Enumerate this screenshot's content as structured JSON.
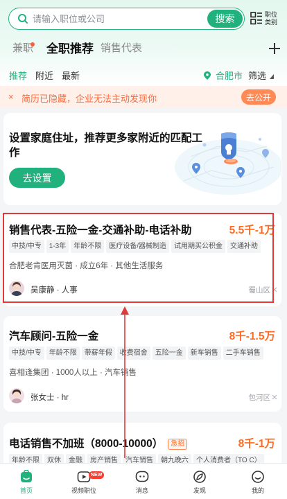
{
  "search": {
    "placeholder": "请输入职位或公司",
    "button_label": "搜索",
    "category_label": "职位类别"
  },
  "tabs": [
    {
      "label": "兼职",
      "has_dot": true
    },
    {
      "label": "全职推荐",
      "active": true
    },
    {
      "label": "销售代表"
    }
  ],
  "subtabs": [
    {
      "label": "推荐",
      "active": true
    },
    {
      "label": "附近"
    },
    {
      "label": "最新"
    }
  ],
  "city": "合肥市",
  "filter_label": "筛选",
  "notice": {
    "close_symbol": "×",
    "text": "简历已隐藏，企业无法主动发现你",
    "button_label": "去公开"
  },
  "address_card": {
    "title": "设置家庭住址，推荐更多家附近的匹配工作",
    "button_label": "去设置"
  },
  "jobs": [
    {
      "title": "销售代表-五险一金-交通补助-电话补助",
      "salary": "5.5千-1万",
      "tags": [
        "中技/中专",
        "1-3年",
        "年龄不限",
        "医疗设备/器械制造",
        "试用期买公积金",
        "交通补助"
      ],
      "company": "合肥老肯医用灭菌 · 成立6年 · 其他生活服务",
      "recruiter": "吴康静 · 人事",
      "district": "蜀山区"
    },
    {
      "title": "汽车顾问-五险一金",
      "salary": "8千-1.5万",
      "tags": [
        "中技/中专",
        "年龄不限",
        "带薪年假",
        "收费宿舍",
        "五险一金",
        "新车销售",
        "二手车销售"
      ],
      "company": "喜相逢集团 · 1000人以上 · 汽车销售",
      "recruiter": "张女士 · hr",
      "district": "包河区"
    },
    {
      "title": "电话销售不加班（8000-10000）",
      "urgent_badge": "急招",
      "salary": "8千-1万",
      "tags": [
        "年龄不限",
        "双休",
        "金融",
        "房产销售",
        "汽车销售",
        "朝九晚六",
        "个人消费者（TO C）"
      ]
    }
  ],
  "bottom_nav": [
    {
      "label": "首页",
      "icon": "home-icon",
      "active": true
    },
    {
      "label": "视频职位",
      "icon": "video-icon",
      "badge": "NEW"
    },
    {
      "label": "消息",
      "icon": "message-icon"
    },
    {
      "label": "发现",
      "icon": "discover-icon"
    },
    {
      "label": "我的",
      "icon": "profile-icon"
    }
  ],
  "colors": {
    "brand_green": "#21b17d",
    "salary_orange": "#ff6a20",
    "notice_orange": "#ff6a3a",
    "highlight_red": "#e0393c"
  }
}
